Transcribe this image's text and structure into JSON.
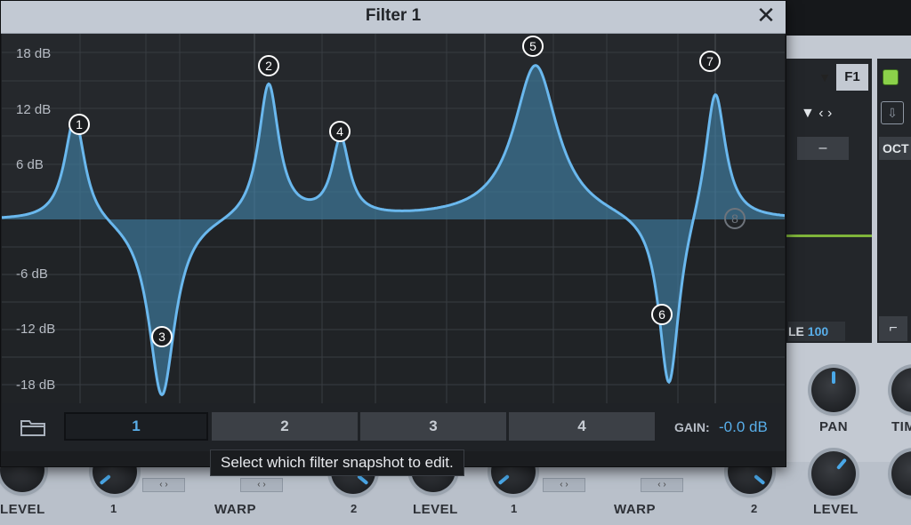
{
  "window": {
    "title": "Filter 1"
  },
  "graph": {
    "db_labels": [
      "18 dB",
      "12 dB",
      "6 dB",
      "-6 dB",
      "-12 dB",
      "-18 dB"
    ],
    "nodes": [
      "1",
      "2",
      "3",
      "4",
      "5",
      "6",
      "7",
      "8"
    ]
  },
  "snapshots": {
    "tabs": [
      "1",
      "2",
      "3",
      "4"
    ],
    "selected": "1"
  },
  "gain": {
    "label": "GAIN:",
    "value": "-0.0 dB"
  },
  "tooltip": "Select which filter snapshot to edit.",
  "background": {
    "f1_label": "F1",
    "oct_label": "OCT",
    "dash": "–",
    "le_label": "LE",
    "le_value": "100",
    "pan_label": "PAN",
    "tim_label": "TIM",
    "level_label": "LEVEL",
    "warp_label": "WARP",
    "warp_min": "1",
    "warp_max": "2"
  },
  "colors": {
    "accent": "#58aee9",
    "curve": "#6ab8ee",
    "fill": "#3f7ea3"
  }
}
